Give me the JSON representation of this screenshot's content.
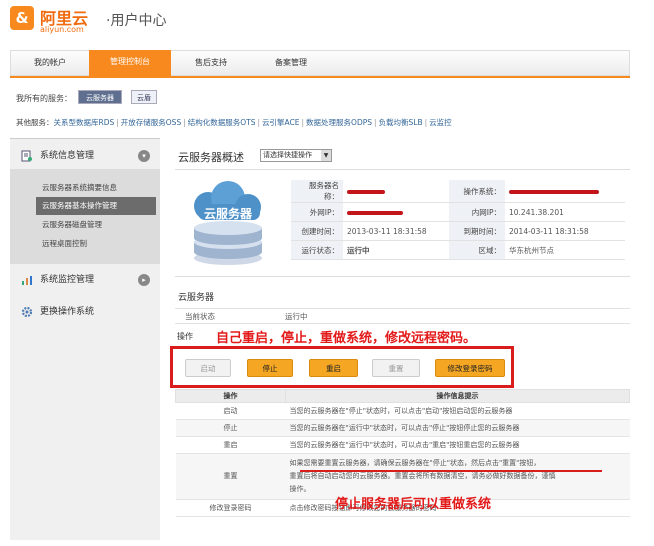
{
  "header": {
    "logo_glyph": "&",
    "brand": "阿里云",
    "domain": "aliyun.com",
    "section": "·用户中心"
  },
  "nav": {
    "tabs": [
      "我的帐户",
      "管理控制台",
      "售后支持",
      "备案管理"
    ],
    "active": 1
  },
  "services": {
    "my_label": "我所有的服务：",
    "selected": "云服务器",
    "other_btn": "云盾",
    "other_label": "其他服务：",
    "others": [
      "关系型数据库RDS",
      "开放存储服务OSS",
      "结构化数据服务OTS",
      "云引擎ACE",
      "数据处理服务ODPS",
      "负载均衡SLB",
      "云监控"
    ]
  },
  "sidebar": {
    "groups": [
      {
        "label": "系统信息管理",
        "icon": "doc-icon",
        "expanded": true
      },
      {
        "label": "系统监控管理",
        "icon": "chart-icon",
        "expanded": false
      },
      {
        "label": "更换操作系统",
        "icon": "gear-icon",
        "expanded": false
      }
    ],
    "items": [
      "云服务器系统摘要信息",
      "云服务器基本操作管理",
      "云服务器磁盘管理",
      "远程桌面控制"
    ],
    "active_item": 1
  },
  "overview": {
    "title": "云服务器概述",
    "quick_select": "请选择快捷操作",
    "image_label": "云服务器",
    "rows": [
      {
        "k1": "服务器名称：",
        "v1": "",
        "k2": "操作系统：",
        "v2": ""
      },
      {
        "k1": "外网IP：",
        "v1": "",
        "k2": "内网IP：",
        "v2": "10.241.38.201"
      },
      {
        "k1": "创建时间：",
        "v1": "2013-03-11 18:31:58",
        "k2": "到期时间：",
        "v2": "2014-03-11 18:31:58"
      },
      {
        "k1": "运行状态：",
        "v1": "运行中",
        "k2": "区域：",
        "v2": "华东杭州节点"
      }
    ]
  },
  "server_section": {
    "title": "云服务器",
    "state_label": "当前状态",
    "state_value": "运行中",
    "op_label": "操作",
    "annotation": "自己重启，停止，重做系统，修改远程密码。",
    "buttons": [
      {
        "label": "启动",
        "enabled": false
      },
      {
        "label": "停止",
        "enabled": true
      },
      {
        "label": "重启",
        "enabled": true
      },
      {
        "label": "重置",
        "enabled": false
      },
      {
        "label": "修改登录密码",
        "enabled": true
      }
    ]
  },
  "ops_table": {
    "headers": [
      "操作",
      "操作信息提示"
    ],
    "rows": [
      {
        "op": "启动",
        "tip": "当您的云服务器在\"停止\"状态时，可以点击\"启动\"按钮启动您的云服务器"
      },
      {
        "op": "停止",
        "tip": "当您的云服务器在\"运行中\"状态时，可以点击\"停止\"按钮停止您的云服务器"
      },
      {
        "op": "重启",
        "tip": "当您的云服务器在\"运行中\"状态时，可以点击\"重启\"按钮重启您的云服务器"
      },
      {
        "op": "重置",
        "tip1": "如果您需要重置云服务器，请确保云服务器在\"停止\"状态，然后点击\"重置\"按钮，",
        "tip2": "重置后将自动启动您的云服务器。重置会将所有数据清空，请务必做好数据备份，谨慎",
        "tip3": "操作。"
      },
      {
        "op": "修改登录密码",
        "tip": "点击修改密码按钮即可修改您的云服务器的密码"
      }
    ],
    "annotation": "停止服务器后可以重做系统"
  }
}
